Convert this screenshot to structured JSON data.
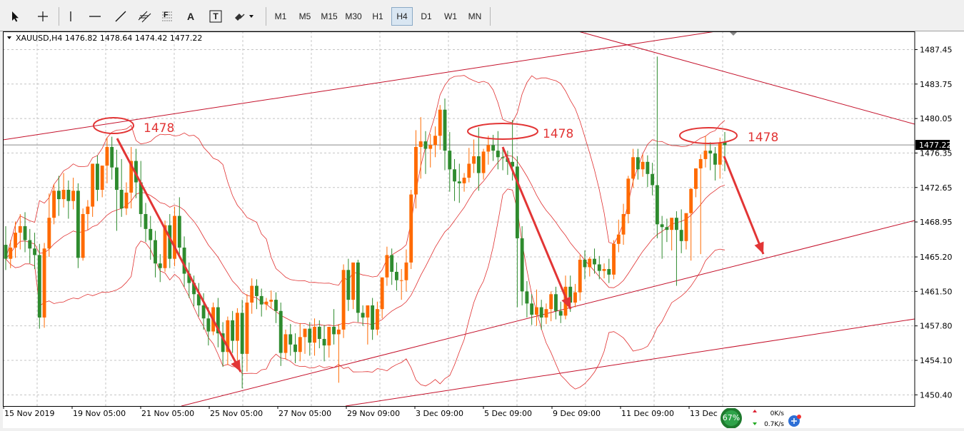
{
  "toolbar": {
    "tools": [
      {
        "icon": "cursor-arrow-icon"
      },
      {
        "icon": "crosshair-icon"
      },
      {
        "icon": "vertical-line-icon"
      },
      {
        "icon": "horizontal-line-icon"
      },
      {
        "icon": "trendline-icon"
      },
      {
        "icon": "equidistant-channel-icon"
      },
      {
        "icon": "fibonacci-icon",
        "label": "F"
      },
      {
        "icon": "text-icon",
        "label": "A"
      },
      {
        "icon": "text-label-icon",
        "label": "T"
      },
      {
        "icon": "shapes-dropdown-icon"
      }
    ],
    "timeframes": [
      "M1",
      "M5",
      "M15",
      "M30",
      "H1",
      "H4",
      "D1",
      "W1",
      "MN"
    ],
    "active_timeframe": "H4"
  },
  "chart": {
    "symbol_line": "XAUUSD,H4  1476.82 1478.64 1474.42 1477.22",
    "current_price_label": "1477.22",
    "annotations": [
      "1478",
      "1478",
      "1478"
    ],
    "colors": {
      "bull": "#ff6a00",
      "bear": "#2e8b2e",
      "indicator": "#e03030",
      "annotation": "#e23535",
      "axis_text": "#000000",
      "current_price_bg": "#000000"
    }
  },
  "status": {
    "cpu": "67%",
    "upload": "0K/s",
    "download": "0.7K/s"
  },
  "chart_data": {
    "type": "candlestick",
    "title": "XAUUSD,H4",
    "y_ticks": [
      1487.45,
      1483.75,
      1480.05,
      1476.35,
      1472.65,
      1468.95,
      1465.2,
      1461.5,
      1457.8,
      1454.1,
      1450.4
    ],
    "y_tick_labels": [
      "1487.45",
      "1483.75",
      "1480.05",
      "1476.35",
      "1472.65",
      "1468.95",
      "1465.20",
      "1461.50",
      "1457.80",
      "1454.10",
      "1450.40"
    ],
    "x_tick_labels": [
      "15 Nov 2019",
      "19 Nov 05:00",
      "21 Nov 05:00",
      "25 Nov 05:00",
      "27 Nov 05:00",
      "29 Nov 09:00",
      "3 Dec 09:00",
      "5 Dec 09:00",
      "9 Dec 09:00",
      "11 Dec 09:00",
      "13 Dec"
    ],
    "ylim": [
      1449.2,
      1489.4
    ],
    "current_price": 1477.22,
    "grid": true,
    "candles": [
      {
        "o": 1466.5,
        "h": 1468.5,
        "c": 1465.0,
        "l": 1463.8
      },
      {
        "o": 1465.0,
        "h": 1467.0,
        "c": 1466.2,
        "l": 1464.0
      },
      {
        "o": 1466.2,
        "h": 1469.0,
        "c": 1467.8,
        "l": 1465.1
      },
      {
        "o": 1467.8,
        "h": 1469.8,
        "c": 1468.5,
        "l": 1466.0
      },
      {
        "o": 1468.5,
        "h": 1470.0,
        "c": 1467.0,
        "l": 1465.7
      },
      {
        "o": 1467.0,
        "h": 1468.2,
        "c": 1466.1,
        "l": 1464.5
      },
      {
        "o": 1466.1,
        "h": 1467.8,
        "c": 1465.4,
        "l": 1463.9
      },
      {
        "o": 1465.4,
        "h": 1466.6,
        "c": 1458.7,
        "l": 1457.5
      },
      {
        "o": 1458.7,
        "h": 1466.7,
        "c": 1466.1,
        "l": 1457.6
      },
      {
        "o": 1466.1,
        "h": 1472.0,
        "c": 1469.4,
        "l": 1465.2
      },
      {
        "o": 1469.4,
        "h": 1473.0,
        "c": 1472.3,
        "l": 1468.7
      },
      {
        "o": 1472.3,
        "h": 1473.9,
        "c": 1471.4,
        "l": 1469.6
      },
      {
        "o": 1471.4,
        "h": 1474.2,
        "c": 1472.4,
        "l": 1470.5
      },
      {
        "o": 1472.4,
        "h": 1473.4,
        "c": 1471.2,
        "l": 1469.3
      },
      {
        "o": 1471.2,
        "h": 1473.7,
        "c": 1472.3,
        "l": 1470.3
      },
      {
        "o": 1472.3,
        "h": 1473.1,
        "c": 1465.1,
        "l": 1464.0
      },
      {
        "o": 1465.1,
        "h": 1470.4,
        "c": 1469.8,
        "l": 1464.8
      },
      {
        "o": 1469.8,
        "h": 1471.3,
        "c": 1470.6,
        "l": 1468.1
      },
      {
        "o": 1470.6,
        "h": 1475.2,
        "c": 1475.2,
        "l": 1469.5
      },
      {
        "o": 1475.2,
        "h": 1476.1,
        "c": 1472.4,
        "l": 1471.2
      },
      {
        "o": 1472.4,
        "h": 1474.6,
        "c": 1475.0,
        "l": 1471.6
      },
      {
        "o": 1475.0,
        "h": 1478.0,
        "c": 1477.0,
        "l": 1473.1
      },
      {
        "o": 1477.0,
        "h": 1478.1,
        "c": 1474.8,
        "l": 1473.5
      },
      {
        "o": 1474.8,
        "h": 1476.7,
        "c": 1472.4,
        "l": 1468.0
      },
      {
        "o": 1472.4,
        "h": 1475.7,
        "c": 1470.4,
        "l": 1469.5
      },
      {
        "o": 1470.4,
        "h": 1473.2,
        "c": 1472.1,
        "l": 1469.7
      },
      {
        "o": 1472.1,
        "h": 1477.0,
        "c": 1475.5,
        "l": 1470.4
      },
      {
        "o": 1475.5,
        "h": 1476.8,
        "c": 1473.2,
        "l": 1471.5
      },
      {
        "o": 1473.2,
        "h": 1475.5,
        "c": 1469.8,
        "l": 1468.4
      },
      {
        "o": 1469.8,
        "h": 1471.0,
        "c": 1468.2,
        "l": 1466.8
      },
      {
        "o": 1468.2,
        "h": 1469.6,
        "c": 1467.0,
        "l": 1464.9
      },
      {
        "o": 1467.0,
        "h": 1468.0,
        "c": 1464.5,
        "l": 1463.0
      },
      {
        "o": 1464.5,
        "h": 1465.5,
        "c": 1464.0,
        "l": 1462.5
      },
      {
        "o": 1464.0,
        "h": 1469.1,
        "c": 1468.6,
        "l": 1463.6
      },
      {
        "o": 1468.6,
        "h": 1469.8,
        "c": 1465.0,
        "l": 1464.0
      },
      {
        "o": 1465.0,
        "h": 1470.6,
        "c": 1469.6,
        "l": 1464.2
      },
      {
        "o": 1469.6,
        "h": 1471.6,
        "c": 1466.2,
        "l": 1465.1
      },
      {
        "o": 1466.2,
        "h": 1467.4,
        "c": 1463.4,
        "l": 1462.0
      },
      {
        "o": 1463.4,
        "h": 1464.6,
        "c": 1462.4,
        "l": 1460.8
      },
      {
        "o": 1462.4,
        "h": 1463.2,
        "c": 1461.2,
        "l": 1459.9
      },
      {
        "o": 1461.2,
        "h": 1462.4,
        "c": 1460.0,
        "l": 1458.8
      },
      {
        "o": 1460.0,
        "h": 1461.3,
        "c": 1458.6,
        "l": 1457.4
      },
      {
        "o": 1458.6,
        "h": 1459.8,
        "c": 1457.2,
        "l": 1455.7
      },
      {
        "o": 1457.2,
        "h": 1460.3,
        "c": 1459.8,
        "l": 1456.8
      },
      {
        "o": 1459.8,
        "h": 1460.8,
        "c": 1457.0,
        "l": 1455.5
      },
      {
        "o": 1457.0,
        "h": 1458.2,
        "c": 1455.0,
        "l": 1453.4
      },
      {
        "o": 1455.0,
        "h": 1458.8,
        "c": 1458.4,
        "l": 1453.6
      },
      {
        "o": 1458.4,
        "h": 1459.4,
        "c": 1456.2,
        "l": 1454.9
      },
      {
        "o": 1456.2,
        "h": 1459.7,
        "c": 1459.2,
        "l": 1454.1
      },
      {
        "o": 1459.2,
        "h": 1460.6,
        "c": 1454.8,
        "l": 1451.1
      },
      {
        "o": 1454.8,
        "h": 1461.2,
        "c": 1460.3,
        "l": 1452.9
      },
      {
        "o": 1460.3,
        "h": 1462.9,
        "c": 1462.1,
        "l": 1459.1
      },
      {
        "o": 1462.1,
        "h": 1462.8,
        "c": 1461.0,
        "l": 1459.6
      },
      {
        "o": 1461.0,
        "h": 1461.8,
        "c": 1460.1,
        "l": 1458.8
      },
      {
        "o": 1460.1,
        "h": 1460.8,
        "c": 1460.4,
        "l": 1459.5
      },
      {
        "o": 1460.4,
        "h": 1461.6,
        "c": 1460.6,
        "l": 1459.7
      },
      {
        "o": 1460.6,
        "h": 1461.4,
        "c": 1459.4,
        "l": 1458.1
      },
      {
        "o": 1459.4,
        "h": 1460.3,
        "c": 1454.9,
        "l": 1453.5
      },
      {
        "o": 1454.9,
        "h": 1457.4,
        "c": 1456.9,
        "l": 1454.2
      },
      {
        "o": 1456.9,
        "h": 1458.0,
        "c": 1455.8,
        "l": 1454.6
      },
      {
        "o": 1455.8,
        "h": 1457.0,
        "c": 1455.0,
        "l": 1453.8
      },
      {
        "o": 1455.0,
        "h": 1458.1,
        "c": 1456.6,
        "l": 1454.0
      },
      {
        "o": 1456.6,
        "h": 1457.3,
        "c": 1457.5,
        "l": 1454.8
      },
      {
        "o": 1457.5,
        "h": 1458.2,
        "c": 1456.0,
        "l": 1454.6
      },
      {
        "o": 1456.0,
        "h": 1458.6,
        "c": 1457.7,
        "l": 1454.6
      },
      {
        "o": 1457.7,
        "h": 1458.4,
        "c": 1456.4,
        "l": 1455.4
      },
      {
        "o": 1456.4,
        "h": 1457.9,
        "c": 1455.7,
        "l": 1454.0
      },
      {
        "o": 1455.7,
        "h": 1457.6,
        "c": 1457.7,
        "l": 1454.4
      },
      {
        "o": 1457.7,
        "h": 1459.6,
        "c": 1456.9,
        "l": 1455.8
      },
      {
        "o": 1456.9,
        "h": 1458.0,
        "c": 1457.4,
        "l": 1451.7
      },
      {
        "o": 1457.4,
        "h": 1464.4,
        "c": 1463.8,
        "l": 1456.5
      },
      {
        "o": 1463.8,
        "h": 1465.0,
        "c": 1460.6,
        "l": 1459.4
      },
      {
        "o": 1460.6,
        "h": 1464.3,
        "c": 1464.6,
        "l": 1459.6
      },
      {
        "o": 1464.6,
        "h": 1464.9,
        "c": 1459.2,
        "l": 1458.2
      },
      {
        "o": 1459.2,
        "h": 1460.0,
        "c": 1458.7,
        "l": 1457.8
      },
      {
        "o": 1458.7,
        "h": 1459.7,
        "c": 1460.0,
        "l": 1455.8
      },
      {
        "o": 1460.0,
        "h": 1460.8,
        "c": 1457.4,
        "l": 1456.3
      },
      {
        "o": 1457.4,
        "h": 1460.4,
        "c": 1459.6,
        "l": 1456.8
      },
      {
        "o": 1459.6,
        "h": 1463.0,
        "c": 1463.0,
        "l": 1458.6
      },
      {
        "o": 1463.0,
        "h": 1466.3,
        "c": 1465.4,
        "l": 1462.1
      },
      {
        "o": 1465.4,
        "h": 1466.1,
        "c": 1463.6,
        "l": 1462.2
      },
      {
        "o": 1463.6,
        "h": 1464.6,
        "c": 1462.7,
        "l": 1461.6
      },
      {
        "o": 1462.7,
        "h": 1463.9,
        "c": 1462.7,
        "l": 1460.6
      },
      {
        "o": 1462.7,
        "h": 1466.0,
        "c": 1464.6,
        "l": 1461.5
      },
      {
        "o": 1464.6,
        "h": 1472.4,
        "c": 1471.9,
        "l": 1463.9
      },
      {
        "o": 1471.9,
        "h": 1478.8,
        "c": 1477.0,
        "l": 1470.4
      },
      {
        "o": 1477.0,
        "h": 1480.2,
        "c": 1477.6,
        "l": 1473.6
      },
      {
        "o": 1477.6,
        "h": 1478.7,
        "c": 1476.8,
        "l": 1474.1
      },
      {
        "o": 1476.8,
        "h": 1478.4,
        "c": 1477.2,
        "l": 1474.8
      },
      {
        "o": 1477.2,
        "h": 1479.2,
        "c": 1478.2,
        "l": 1475.9
      },
      {
        "o": 1478.2,
        "h": 1481.5,
        "c": 1481.0,
        "l": 1476.7
      },
      {
        "o": 1481.0,
        "h": 1482.2,
        "c": 1476.6,
        "l": 1474.5
      },
      {
        "o": 1476.6,
        "h": 1478.6,
        "c": 1474.6,
        "l": 1472.2
      },
      {
        "o": 1474.6,
        "h": 1475.7,
        "c": 1473.3,
        "l": 1471.2
      },
      {
        "o": 1473.3,
        "h": 1475.2,
        "c": 1473.1,
        "l": 1471.0
      },
      {
        "o": 1473.1,
        "h": 1474.2,
        "c": 1473.7,
        "l": 1472.2
      },
      {
        "o": 1473.7,
        "h": 1476.9,
        "c": 1475.2,
        "l": 1473.2
      },
      {
        "o": 1475.2,
        "h": 1477.8,
        "c": 1476.0,
        "l": 1474.2
      },
      {
        "o": 1476.0,
        "h": 1479.1,
        "c": 1474.2,
        "l": 1472.3
      },
      {
        "o": 1474.2,
        "h": 1476.8,
        "c": 1476.5,
        "l": 1473.5
      },
      {
        "o": 1476.5,
        "h": 1478.2,
        "c": 1477.2,
        "l": 1475.1
      },
      {
        "o": 1477.2,
        "h": 1478.3,
        "c": 1476.6,
        "l": 1475.5
      },
      {
        "o": 1476.6,
        "h": 1478.7,
        "c": 1475.9,
        "l": 1474.6
      },
      {
        "o": 1475.9,
        "h": 1476.8,
        "c": 1475.8,
        "l": 1474.5
      },
      {
        "o": 1475.8,
        "h": 1476.6,
        "c": 1475.4,
        "l": 1474.0
      },
      {
        "o": 1475.4,
        "h": 1479.9,
        "c": 1474.9,
        "l": 1473.4
      },
      {
        "o": 1474.9,
        "h": 1476.0,
        "c": 1467.2,
        "l": 1459.8
      },
      {
        "o": 1467.2,
        "h": 1468.5,
        "c": 1461.5,
        "l": 1460.0
      },
      {
        "o": 1461.5,
        "h": 1462.6,
        "c": 1460.2,
        "l": 1458.7
      },
      {
        "o": 1460.2,
        "h": 1461.2,
        "c": 1459.0,
        "l": 1457.9
      },
      {
        "o": 1459.0,
        "h": 1461.7,
        "c": 1459.8,
        "l": 1457.8
      },
      {
        "o": 1459.8,
        "h": 1460.6,
        "c": 1458.7,
        "l": 1457.4
      },
      {
        "o": 1458.7,
        "h": 1460.2,
        "c": 1459.6,
        "l": 1458.0
      },
      {
        "o": 1459.6,
        "h": 1461.5,
        "c": 1461.2,
        "l": 1458.3
      },
      {
        "o": 1461.2,
        "h": 1462.0,
        "c": 1459.4,
        "l": 1458.5
      },
      {
        "o": 1459.4,
        "h": 1460.4,
        "c": 1458.9,
        "l": 1458.1
      },
      {
        "o": 1458.9,
        "h": 1463.2,
        "c": 1462.0,
        "l": 1458.5
      },
      {
        "o": 1462.0,
        "h": 1463.2,
        "c": 1460.3,
        "l": 1459.3
      },
      {
        "o": 1460.3,
        "h": 1462.3,
        "c": 1461.4,
        "l": 1459.8
      },
      {
        "o": 1461.4,
        "h": 1465.4,
        "c": 1464.9,
        "l": 1460.5
      },
      {
        "o": 1464.9,
        "h": 1465.9,
        "c": 1464.1,
        "l": 1462.8
      },
      {
        "o": 1464.1,
        "h": 1465.2,
        "c": 1465.0,
        "l": 1463.1
      },
      {
        "o": 1465.0,
        "h": 1466.1,
        "c": 1464.4,
        "l": 1463.4
      },
      {
        "o": 1464.4,
        "h": 1465.3,
        "c": 1463.7,
        "l": 1462.8
      },
      {
        "o": 1463.7,
        "h": 1464.5,
        "c": 1463.9,
        "l": 1462.9
      },
      {
        "o": 1463.9,
        "h": 1465.0,
        "c": 1463.3,
        "l": 1462.4
      },
      {
        "o": 1463.3,
        "h": 1467.0,
        "c": 1466.6,
        "l": 1462.8
      },
      {
        "o": 1466.6,
        "h": 1469.2,
        "c": 1467.6,
        "l": 1465.7
      },
      {
        "o": 1467.6,
        "h": 1470.9,
        "c": 1469.8,
        "l": 1466.5
      },
      {
        "o": 1469.8,
        "h": 1473.9,
        "c": 1473.6,
        "l": 1468.8
      },
      {
        "o": 1473.6,
        "h": 1476.8,
        "c": 1475.9,
        "l": 1472.6
      },
      {
        "o": 1475.9,
        "h": 1476.8,
        "c": 1474.6,
        "l": 1473.5
      },
      {
        "o": 1474.6,
        "h": 1476.2,
        "c": 1475.4,
        "l": 1473.8
      },
      {
        "o": 1475.4,
        "h": 1476.1,
        "c": 1474.1,
        "l": 1472.7
      },
      {
        "o": 1474.1,
        "h": 1475.3,
        "c": 1472.9,
        "l": 1471.8
      },
      {
        "o": 1472.9,
        "h": 1486.7,
        "c": 1468.7,
        "l": 1467.2
      },
      {
        "o": 1468.7,
        "h": 1469.6,
        "c": 1468.4,
        "l": 1465.0
      },
      {
        "o": 1468.4,
        "h": 1469.3,
        "c": 1468.1,
        "l": 1466.8
      },
      {
        "o": 1468.1,
        "h": 1469.0,
        "c": 1469.4,
        "l": 1465.9
      },
      {
        "o": 1469.4,
        "h": 1470.1,
        "c": 1468.1,
        "l": 1462.1
      },
      {
        "o": 1468.1,
        "h": 1470.3,
        "c": 1466.9,
        "l": 1465.6
      },
      {
        "o": 1466.9,
        "h": 1469.5,
        "c": 1469.9,
        "l": 1466.0
      },
      {
        "o": 1469.9,
        "h": 1472.6,
        "c": 1472.5,
        "l": 1464.8
      },
      {
        "o": 1472.5,
        "h": 1474.0,
        "c": 1474.7,
        "l": 1471.6
      },
      {
        "o": 1474.7,
        "h": 1476.2,
        "c": 1475.7,
        "l": 1465.5
      },
      {
        "o": 1475.7,
        "h": 1478.2,
        "c": 1476.6,
        "l": 1474.8
      },
      {
        "o": 1476.6,
        "h": 1477.5,
        "c": 1476.3,
        "l": 1474.5
      },
      {
        "o": 1476.3,
        "h": 1477.0,
        "c": 1475.1,
        "l": 1473.4
      },
      {
        "o": 1475.1,
        "h": 1478.0,
        "c": 1477.5,
        "l": 1473.6
      },
      {
        "o": 1477.5,
        "h": 1478.6,
        "c": 1477.2,
        "l": 1474.4
      }
    ]
  }
}
